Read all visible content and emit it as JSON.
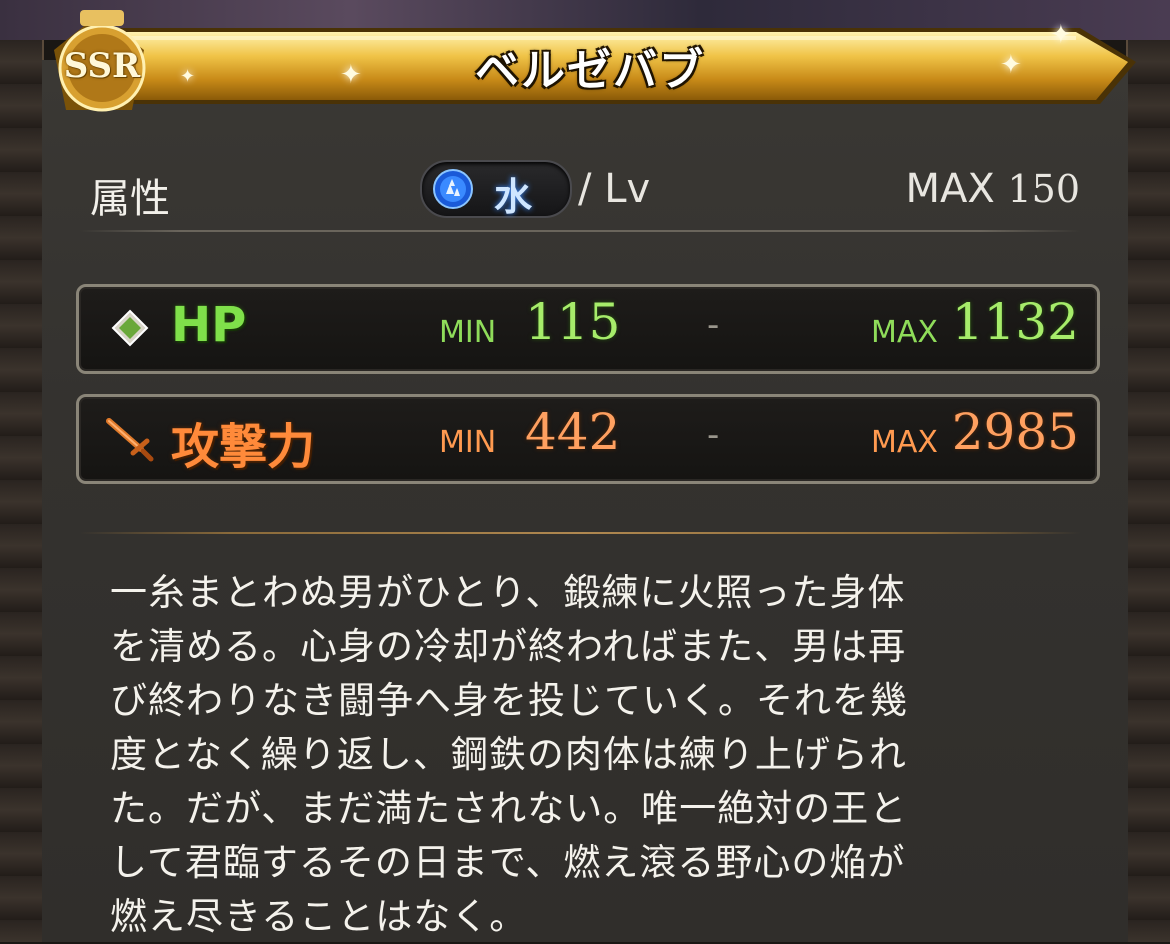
{
  "character": {
    "rarity": "SSR",
    "name": "ベルゼバブ"
  },
  "attribute": {
    "label": "属性",
    "element_icon": "water-drop-icon",
    "element": "水",
    "separator": "/ Lv",
    "max_label": "MAX",
    "max_level": "150"
  },
  "stats": {
    "hp": {
      "icon": "diamond-icon",
      "label": "HP",
      "min_label": "MIN",
      "min": "115",
      "dash": "-",
      "max_label": "MAX",
      "max": "1132"
    },
    "attack": {
      "icon": "sword-icon",
      "label": "攻撃力",
      "min_label": "MIN",
      "min": "442",
      "dash": "-",
      "max_label": "MAX",
      "max": "2985"
    }
  },
  "flavor_text": [
    "一糸まとわぬ男がひとり、鍛練に火照った身体",
    "を清める。心身の冷却が終わればまた、男は再",
    "び終わりなき闘争へ身を投じていく。それを幾",
    "度となく繰り返し、鋼鉄の肉体は練り上げられ",
    "た。だが、まだ満たされない。唯一絶対の王と",
    "して君臨するその日まで、燃え滾る野心の焔が",
    "燃え尽きることはなく。"
  ],
  "colors": {
    "hp": "#7fe04a",
    "attack": "#ff8a3a",
    "banner_gold": "#e8b838",
    "water": "#3a8aff"
  }
}
